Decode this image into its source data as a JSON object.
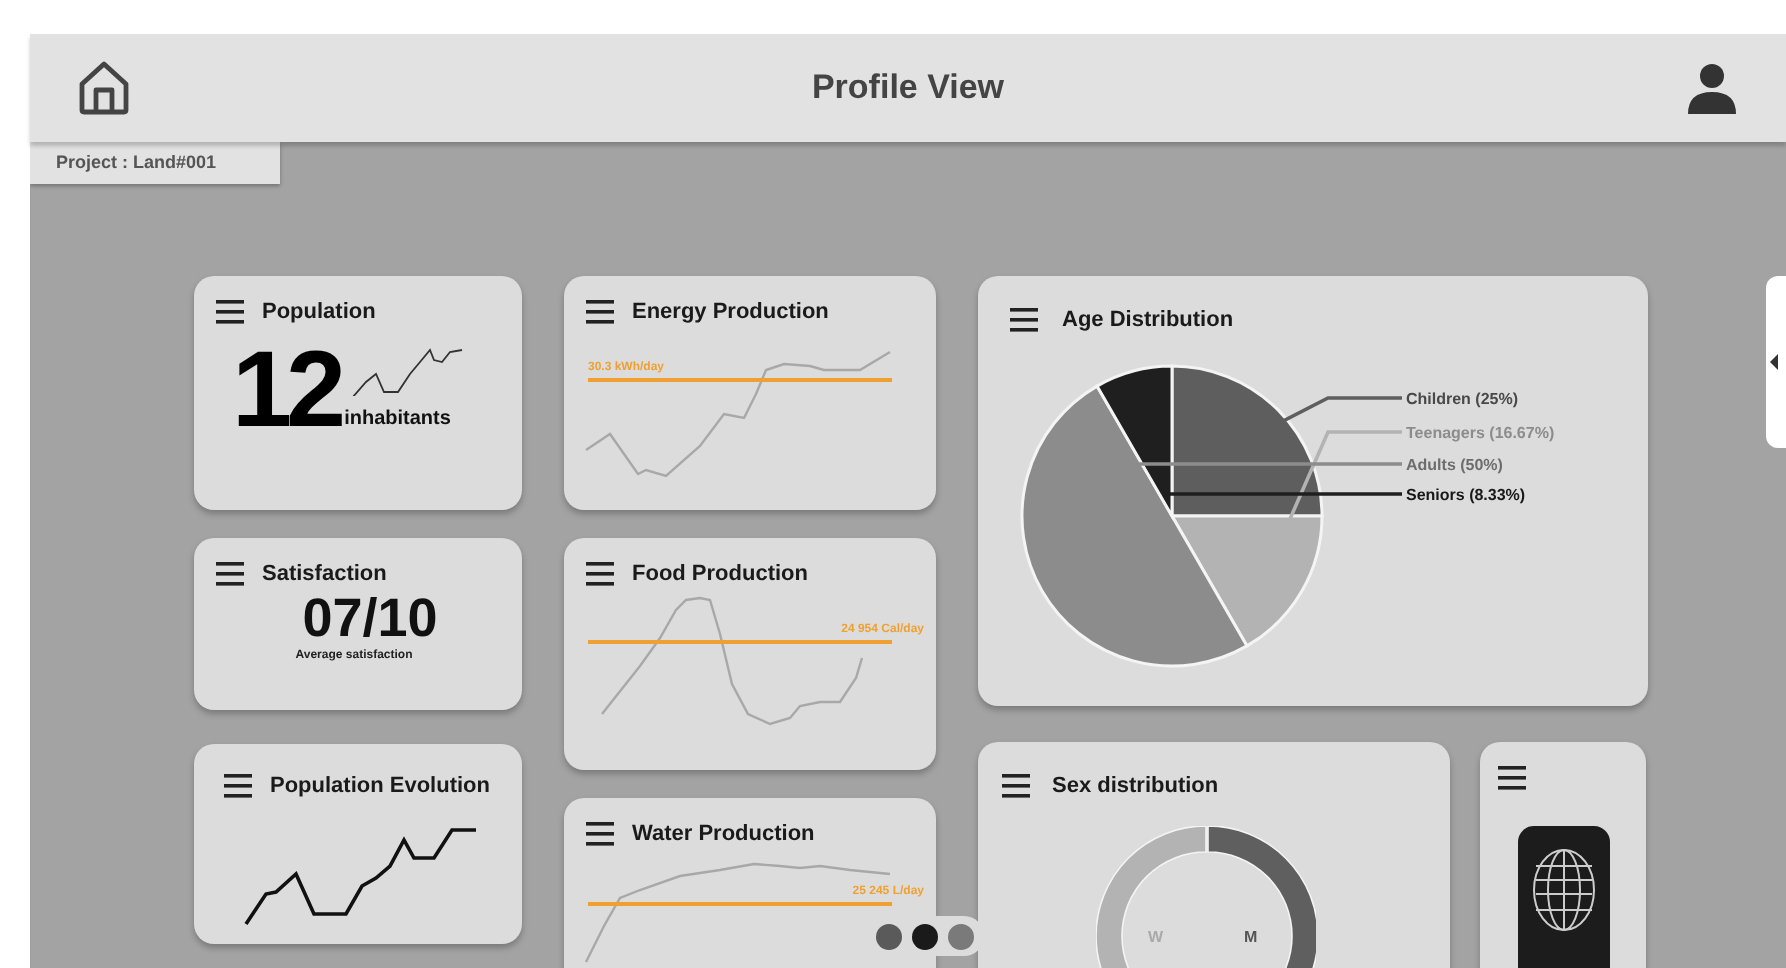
{
  "header": {
    "title": "Profile View"
  },
  "project_tag": "Project : Land#001",
  "population": {
    "title": "Population",
    "value": "12",
    "unit": "inhabitants"
  },
  "satisfaction": {
    "title": "Satisfaction",
    "value": "07/10",
    "caption": "Average satisfaction"
  },
  "population_evolution": {
    "title": "Population Evolution"
  },
  "energy_production": {
    "title": "Energy Production",
    "target_label": "30.3 kWh/day"
  },
  "food_production": {
    "title": "Food Production",
    "target_label": "24 954 Cal/day"
  },
  "water_production": {
    "title": "Water Production",
    "target_label": "25 245 L/day"
  },
  "age_distribution": {
    "title": "Age Distribution",
    "chart_data": {
      "type": "pie",
      "categories": [
        "Children (25%)",
        "Teenagers (16.67%)",
        "Adults (50%)",
        "Seniors (8.33%)"
      ],
      "values": [
        25,
        16.67,
        50,
        8.33
      ]
    },
    "slices": [
      {
        "color": "#5e5e5e"
      },
      {
        "color": "#b3b3b3"
      },
      {
        "color": "#8c8c8c"
      },
      {
        "color": "#1f1f1f"
      }
    ]
  },
  "sex_distribution": {
    "title": "Sex distribution",
    "labels": [
      "W",
      "M"
    ]
  },
  "pagination": {
    "pages": [
      {
        "selected": false
      },
      {
        "selected": true
      },
      {
        "selected": false
      }
    ]
  }
}
